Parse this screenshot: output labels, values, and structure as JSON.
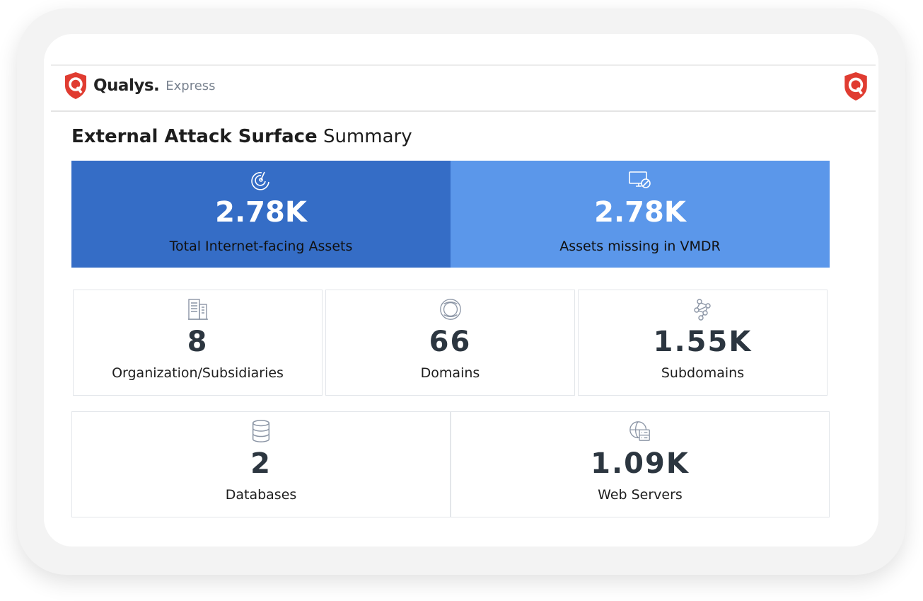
{
  "header": {
    "brand": "Qualys.",
    "product": "Express"
  },
  "title": {
    "bold": "External Attack Surface",
    "rest": "Summary"
  },
  "summary": [
    {
      "icon": "radar-icon",
      "value": "2.78K",
      "label": "Total Internet-facing Assets",
      "color": "#356dc6"
    },
    {
      "icon": "monitor-blocked-icon",
      "value": "2.78K",
      "label": "Assets missing in VMDR",
      "color": "#5b97ea"
    }
  ],
  "stats": [
    {
      "icon": "building-icon",
      "value": "8",
      "label": "Organization/Subsidiaries"
    },
    {
      "icon": "globe-icon",
      "value": "66",
      "label": "Domains"
    },
    {
      "icon": "network-icon",
      "value": "1.55K",
      "label": "Subdomains"
    },
    {
      "icon": "database-icon",
      "value": "2",
      "label": "Databases"
    },
    {
      "icon": "web-server-icon",
      "value": "1.09K",
      "label": "Web Servers"
    }
  ]
}
